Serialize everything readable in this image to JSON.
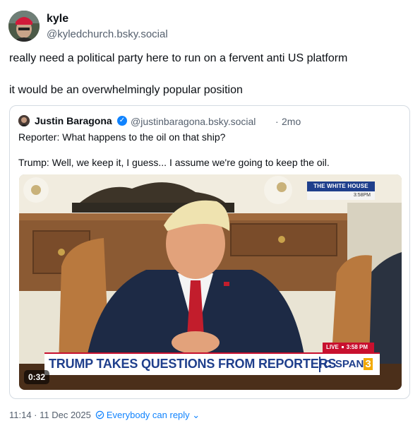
{
  "post": {
    "author": {
      "name": "kyle",
      "handle": "@kyledchurch.bsky.social",
      "avatar_icon": "avatar-image"
    },
    "paragraphs": [
      "really need a political party here to run on a fervent anti US platform",
      "it would be an overwhelmingly popular position"
    ],
    "timestamp": "11:14 · 11 Dec 2025",
    "reply_setting": "Everybody can reply",
    "reply_setting_icon": "globe-reply-icon",
    "dropdown_icon": "chevron-down-icon"
  },
  "quote": {
    "author": {
      "name": "Justin Baragona",
      "handle": "@justinbaragona.bsky.social",
      "verified": true,
      "verified_icon": "verified-check-icon"
    },
    "separator": "·",
    "time": "2mo",
    "paragraphs": [
      "Reporter: What happens to the oil on that ship?",
      "Trump: Well, we keep it, I guess... I assume we're going to keep the oil."
    ],
    "video": {
      "duration": "0:32",
      "bug_title": "THE WHITE HOUSE",
      "bug_time": "3:58PM",
      "live_label": "LIVE",
      "live_time": "3:58 PM",
      "headline": "TRUMP TAKES QUESTIONS FROM REPORTERS",
      "network": "C·SPAN",
      "network_channel": "3"
    }
  },
  "colors": {
    "accent": "#1083fe",
    "text": "#0b0f14",
    "muted": "#55606e",
    "border": "#d4dbe2",
    "cspan_blue": "#1f3f8c",
    "cspan_red": "#c8102e"
  }
}
